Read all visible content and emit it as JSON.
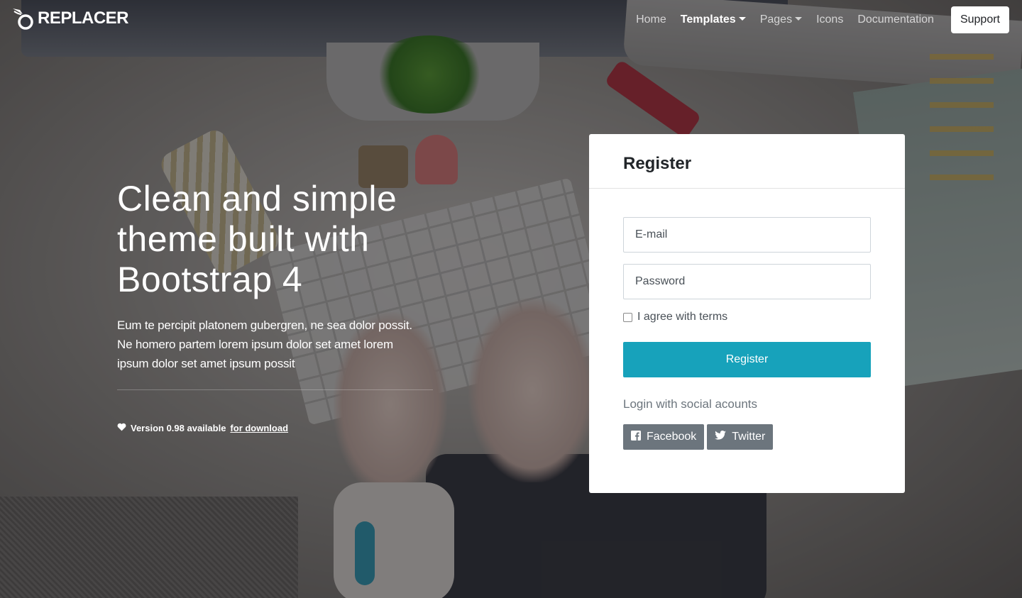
{
  "colors": {
    "accent": "#17a2bb",
    "social": "#6c757d",
    "card": "#ffffff"
  },
  "navbar": {
    "brand": "REPLACER",
    "brand_icon": "bird-logo-icon",
    "links": [
      {
        "label": "Home",
        "active": false,
        "dropdown": false
      },
      {
        "label": "Templates",
        "active": true,
        "dropdown": true
      },
      {
        "label": "Pages",
        "active": false,
        "dropdown": true
      },
      {
        "label": "Icons",
        "active": false,
        "dropdown": false
      },
      {
        "label": "Documentation",
        "active": false,
        "dropdown": false
      }
    ],
    "support_label": "Support"
  },
  "hero": {
    "title_line1": "Clean and simple",
    "title_line2": "theme built with",
    "title_line3": "Bootstrap 4",
    "text_line1": "Eum te percipit platonem gubergren, ne sea dolor possit.",
    "text_line2": "Ne homero partem lorem ipsum dolor set amet lorem",
    "text_line3": "ipsum dolor set amet ipsum possit",
    "version_text": "Version 0.98 available",
    "version_link": "for download",
    "version_icon": "heart-icon"
  },
  "register": {
    "title": "Register",
    "email_placeholder": "E-mail",
    "password_placeholder": "Password",
    "agree_label": "I agree with terms",
    "agree_checked": false,
    "submit_label": "Register",
    "social_label": "Login with social acounts",
    "facebook_label": "Facebook",
    "facebook_icon": "facebook-icon",
    "twitter_label": "Twitter",
    "twitter_icon": "twitter-icon"
  }
}
